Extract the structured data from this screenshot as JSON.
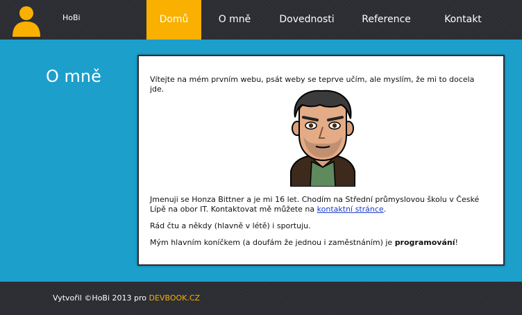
{
  "header": {
    "brand": "HoBi",
    "nav": [
      {
        "label": "Domů",
        "active": true
      },
      {
        "label": "O mně",
        "active": false
      },
      {
        "label": "Dovednosti",
        "active": false
      },
      {
        "label": "Reference",
        "active": false
      },
      {
        "label": "Kontakt",
        "active": false
      }
    ]
  },
  "main": {
    "title": "O mně",
    "p1": "Vítejte na mém prvním webu, psát weby se teprve učím, ale myslím, že mi to docela jde.",
    "p2_text": "Jmenuji se Honza Bittner a je mi 16 let. Chodím na Střední průmyslovou školu v České Lípě na obor IT. Kontaktovat mě můžete na ",
    "p2_link": "kontaktní stránce",
    "p2_end": ".",
    "p3": "Rád čtu a někdy (hlavně v létě) i sportuju.",
    "p4_text": "Mým hlavním koníčkem (a doufám že jednou i zaměstnáním) je ",
    "p4_bold": "programování",
    "p4_end": "!"
  },
  "footer": {
    "text": "Vytvořil ©HoBi 2013 pro ",
    "link": "DEVBOOK.CZ"
  },
  "colors": {
    "accent": "#f9b000",
    "background": "#1c9fcb",
    "dark": "#2b2d33"
  }
}
